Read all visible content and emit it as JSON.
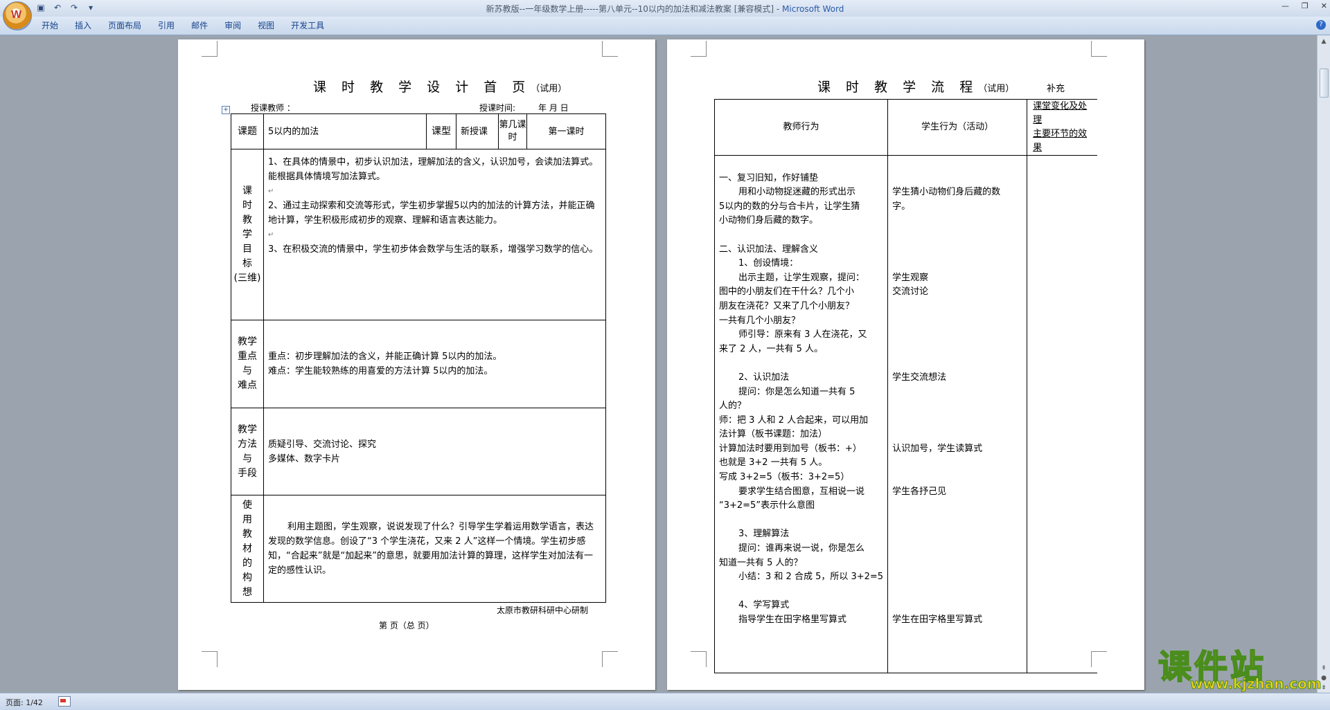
{
  "window": {
    "title": "新苏教版--一年级数学上册-----第八单元--10以内的加法和减法教案 [兼容模式] - ",
    "app_name": "Microsoft Word",
    "office_button_glyph": "W"
  },
  "ribbon": {
    "tabs": [
      "开始",
      "插入",
      "页面布局",
      "引用",
      "邮件",
      "审阅",
      "视图",
      "开发工具"
    ],
    "help_glyph": "?"
  },
  "status": {
    "page": "页面: 1/42"
  },
  "page1": {
    "title": "课 时 教 学 设 计 首 页",
    "title_suffix": "（试用）",
    "teacher_label": "授课教师 ：",
    "time_label": "授课时间:",
    "date_labels": "年    月    日",
    "row1": {
      "topic_label": "课题",
      "topic_value": "5以内的加法",
      "type_label": "课型",
      "type_value": "新授课",
      "which_label": "第几课时",
      "which_value": "第一课时"
    },
    "goals_label": [
      "课",
      "时",
      "教",
      "学",
      "目",
      "标",
      "(三维)"
    ],
    "goals": [
      "1、在具体的情景中，初步认识加法，理解加法的含义，认识加号，会读加法算式。能根据具体情境写加法算式。",
      "2、通过主动探索和交流等形式，学生初步掌握5以内的加法的计算方法，并能正确地计算，学生积极形成初步的观察、理解和语言表达能力。",
      "3、在积极交流的情景中，学生初步体会数学与生活的联系，增强学习数学的信心。"
    ],
    "keypoints_label": [
      "教学",
      "重点",
      "与",
      "难点"
    ],
    "keypoints": [
      "重点：初步理解加法的含义，并能正确计算 5以内的加法。",
      "难点：学生能较熟练的用喜爱的方法计算 5以内的加法。"
    ],
    "methods_label": [
      "教学",
      "方法",
      "与",
      "手段"
    ],
    "methods": [
      "质疑引导、交流讨论、探究",
      "多媒体、数字卡片"
    ],
    "material_label": [
      "使",
      "用",
      "教",
      "材",
      "的",
      "构",
      "想"
    ],
    "material": "利用主题图，学生观察，说说发现了什么？引导学生学着运用数学语言，表达发现的数学信息。创设了“3 个学生浇花，又来 2 人”这样一个情境。学生初步感知，“合起来”就是“加起来”的意思，就要用加法计算的算理，这样学生对加法有一定的感性认识。",
    "footer_org": "太原市教研科研中心研制",
    "footer_page": "第    页（总    页）"
  },
  "page2": {
    "title": "课 时 教 学 流 程",
    "title_suffix": "（试用）",
    "supplement": "补充",
    "col_teacher": "教师行为",
    "col_student": "学生行为（活动）",
    "col_change_1": "课堂变化及处理",
    "col_change_2": "主要环节的效果",
    "teacher_lines": [
      "",
      "一、复习旧知，作好铺垫",
      "    用和小动物捉迷藏的形式出示",
      "5以内的数的分与合卡片，让学生猜",
      "小动物们身后藏的数字。",
      "",
      "二、认识加法、理解含义",
      "    1、创设情境：",
      "    出示主题，让学生观察，提问：",
      "图中的小朋友们在干什么？几个小",
      "朋友在浇花？又来了几个小朋友？",
      "一共有几个小朋友？",
      "    师引导：原来有 3 人在浇花，又",
      "来了 2 人，一共有 5 人。",
      "",
      "    2、认识加法",
      "    提问：你是怎么知道一共有  5",
      "人的？",
      "师：把 3 人和 2 人合起来，可以用加",
      "法计算（板书课题：加法）",
      "计算加法时要用到加号（板书：+）",
      "也就是 3+2   一共有 5 人。",
      "写成 3+2=5（板书：3+2=5）",
      "    要求学生结合图意，互相说一说",
      "“3+2=5”表示什么意图",
      "",
      "    3、理解算法",
      "    提问：谁再来说一说，你是怎么",
      "知道一共有 5 人的？",
      "    小结：3 和 2 合成 5，所以 3+2=5",
      "",
      "    4、学写算式",
      "    指导学生在田字格里写算式",
      "",
      ""
    ],
    "student_lines": [
      "",
      "",
      "学生猜小动物们身后藏的数",
      "字。",
      "",
      "",
      "",
      "",
      "学生观察",
      "交流讨论",
      "",
      "",
      "",
      "",
      "",
      "学生交流想法",
      "",
      "",
      "",
      "",
      "认识加号，学生读算式",
      "",
      "",
      "学生各抒己见",
      "",
      "",
      "",
      "",
      "",
      "",
      "",
      "",
      "学生在田字格里写算式",
      "",
      ""
    ]
  },
  "watermark": {
    "text": "课件站",
    "url": "www.kjzhan.com"
  }
}
